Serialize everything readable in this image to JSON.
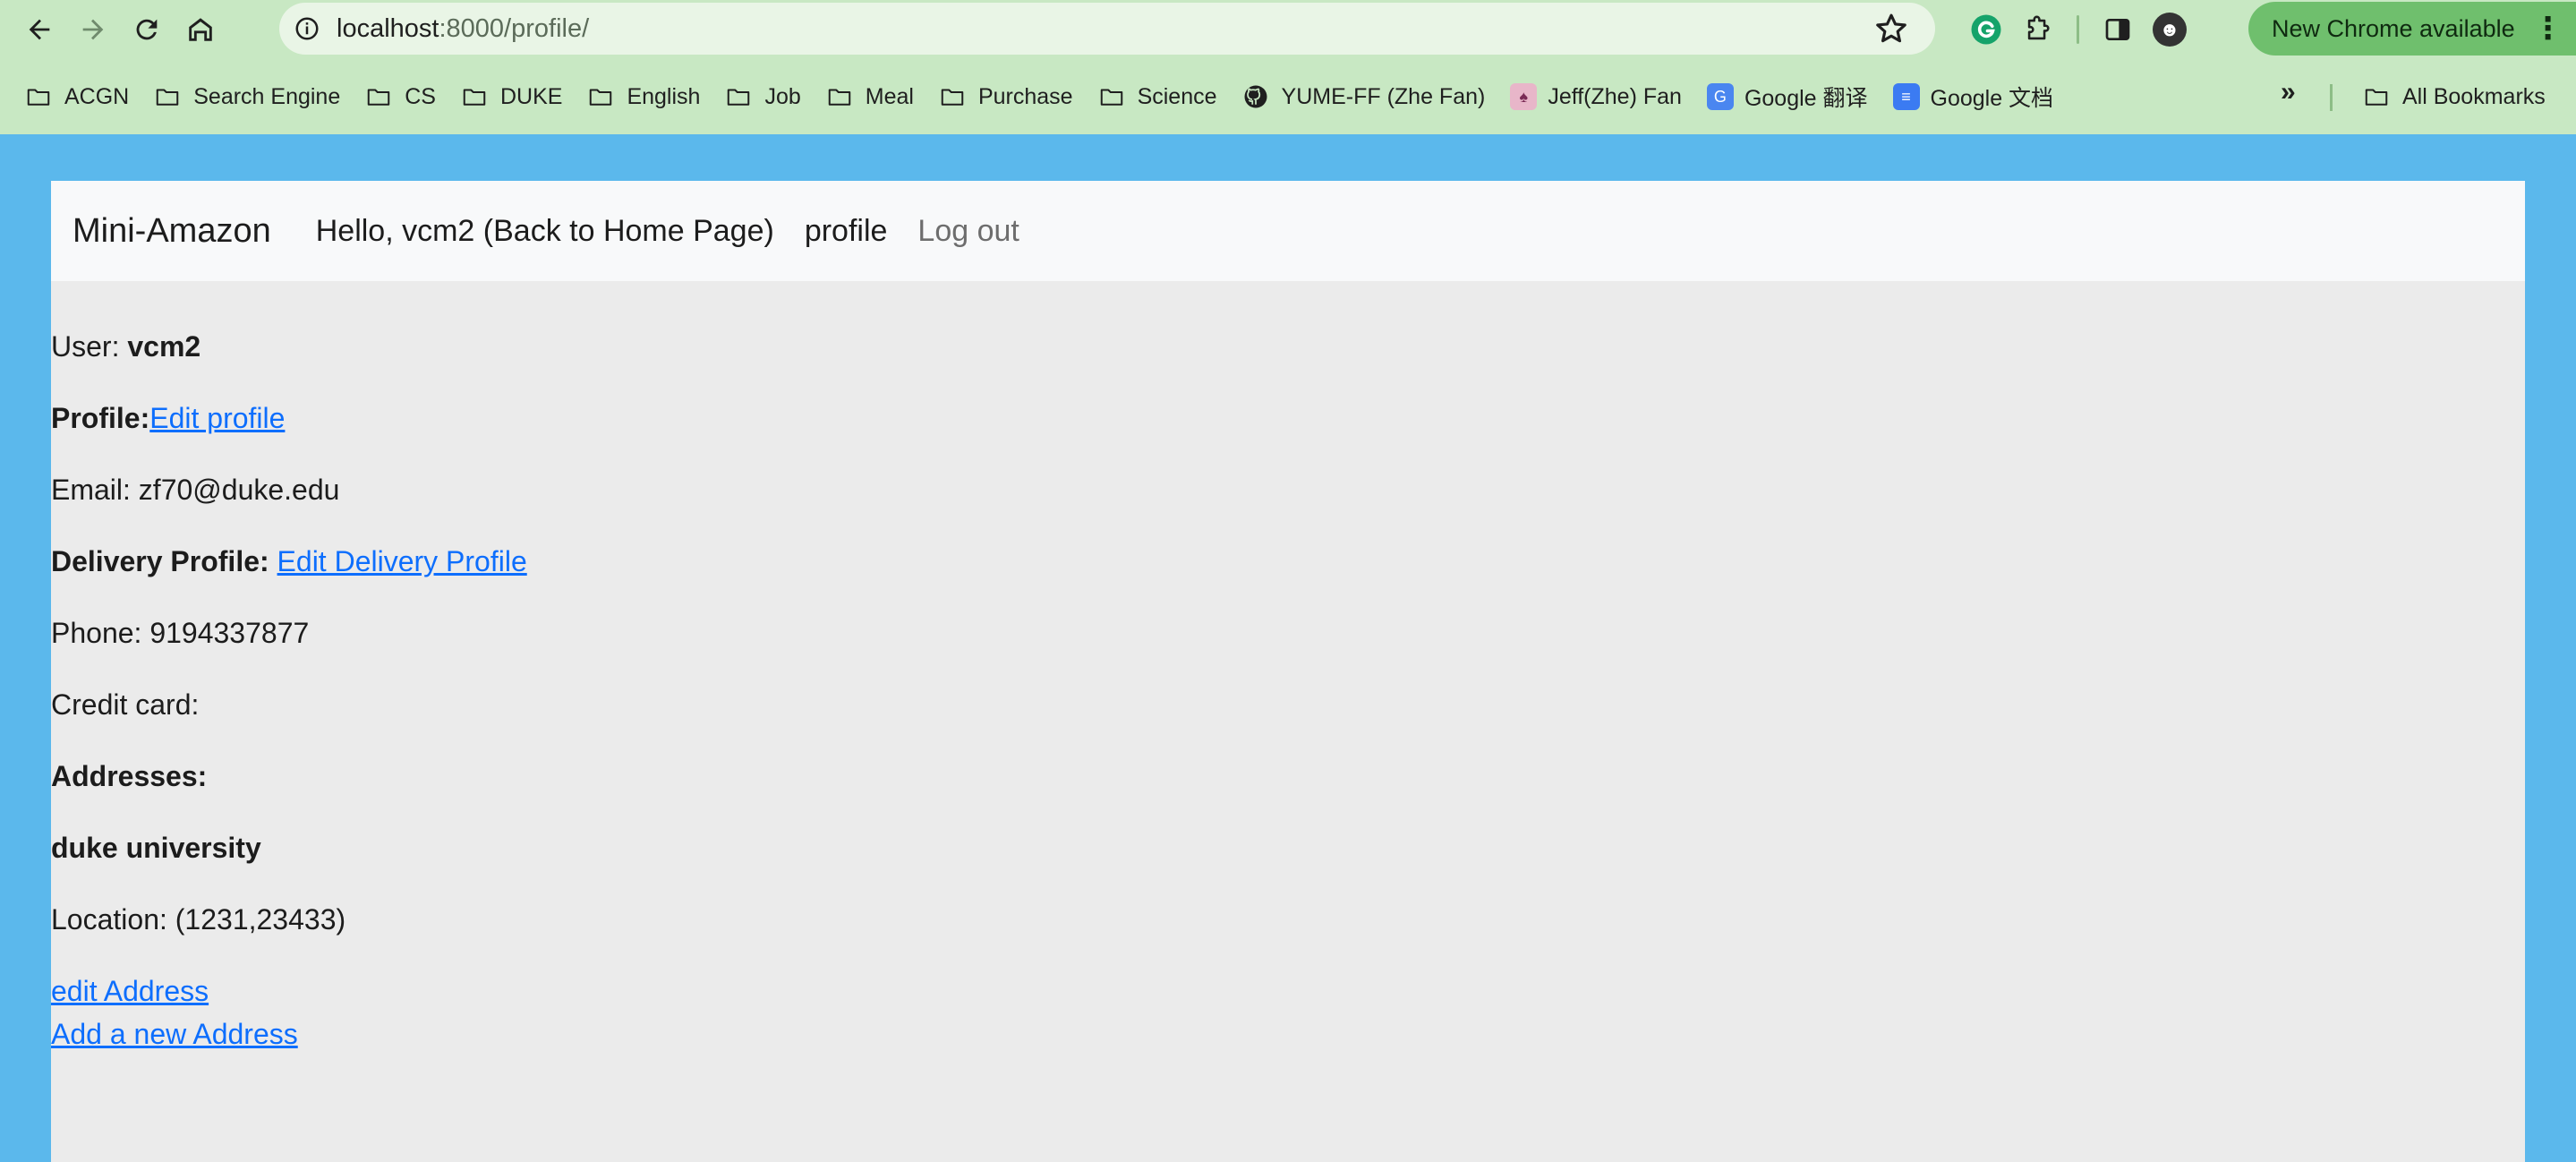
{
  "browser": {
    "url_host": "localhost",
    "url_path": ":8000/profile/",
    "update_label": "New Chrome available",
    "bookmarks": [
      {
        "label": "ACGN",
        "icon": "folder-icon"
      },
      {
        "label": "Search Engine",
        "icon": "folder-icon"
      },
      {
        "label": "CS",
        "icon": "folder-icon"
      },
      {
        "label": "DUKE",
        "icon": "folder-icon"
      },
      {
        "label": "English",
        "icon": "folder-icon"
      },
      {
        "label": "Job",
        "icon": "folder-icon"
      },
      {
        "label": "Meal",
        "icon": "folder-icon"
      },
      {
        "label": "Purchase",
        "icon": "folder-icon"
      },
      {
        "label": "Science",
        "icon": "folder-icon"
      },
      {
        "label": "YUME-FF (Zhe Fan)",
        "icon": "github-icon"
      },
      {
        "label": "Jeff(Zhe) Fan",
        "icon": "profile-favicon-icon"
      },
      {
        "label": "Google 翻译",
        "icon": "google-translate-icon"
      },
      {
        "label": "Google 文档",
        "icon": "google-docs-icon"
      }
    ],
    "all_bookmarks_label": "All Bookmarks",
    "more_label": "»"
  },
  "navbar": {
    "brand": "Mini-Amazon",
    "greeting": "Hello, vcm2 (Back to Home Page)",
    "profile": "profile",
    "logout": "Log out"
  },
  "profile": {
    "user_label": "User: ",
    "username": "vcm2",
    "profile_label": "Profile:",
    "edit_profile": "Edit profile",
    "email": "Email: zf70@duke.edu",
    "delivery_label": "Delivery Profile: ",
    "edit_delivery": "Edit Delivery Profile",
    "phone": "Phone: 9194337877",
    "credit_card": "Credit card:",
    "addresses_label": "Addresses:",
    "address_name": "duke university",
    "location": "Location: (1231,23433)",
    "edit_address": "edit Address",
    "add_address": "Add a new Address"
  },
  "colors": {
    "page_background": "#5bb8ec",
    "browser_chrome": "#c8e8c3",
    "link": "#0d6efd",
    "update_pill": "#6fbf6d"
  }
}
